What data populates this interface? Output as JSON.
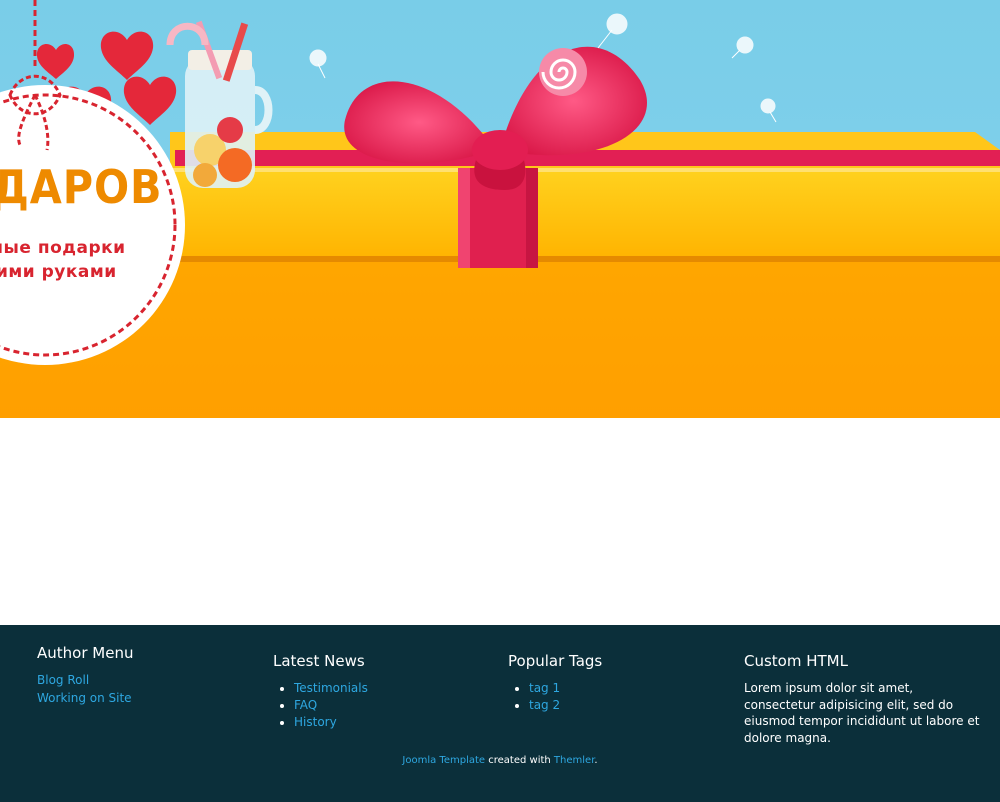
{
  "header": {
    "logo_title": "ДАРОВ",
    "logo_sub_line1": "вные подарки",
    "logo_sub_line2": "ими руками",
    "colors": {
      "sky": "#7fcfea",
      "box": "#ffa000",
      "ribbon": "#e0204f",
      "logo_text": "#ee8a00",
      "logo_sub": "#d8242f"
    }
  },
  "footer": {
    "author_menu": {
      "title": "Author Menu",
      "items": [
        "Blog Roll",
        "Working on Site"
      ]
    },
    "latest_news": {
      "title": "Latest News",
      "items": [
        "Testimonials",
        "FAQ",
        "History"
      ]
    },
    "popular_tags": {
      "title": "Popular Tags",
      "items": [
        "tag 1",
        "tag 2"
      ]
    },
    "custom_html": {
      "title": "Custom HTML",
      "text": "Lorem ipsum dolor sit amet, consectetur adipisicing elit, sed do eiusmod tempor incididunt ut labore et dolore magna."
    },
    "credits": {
      "link1": "Joomla Template",
      "middle": " created with ",
      "link2": "Themler",
      "end": "."
    },
    "colors": {
      "background": "#0b2f3a",
      "link": "#2ea7e0"
    }
  }
}
